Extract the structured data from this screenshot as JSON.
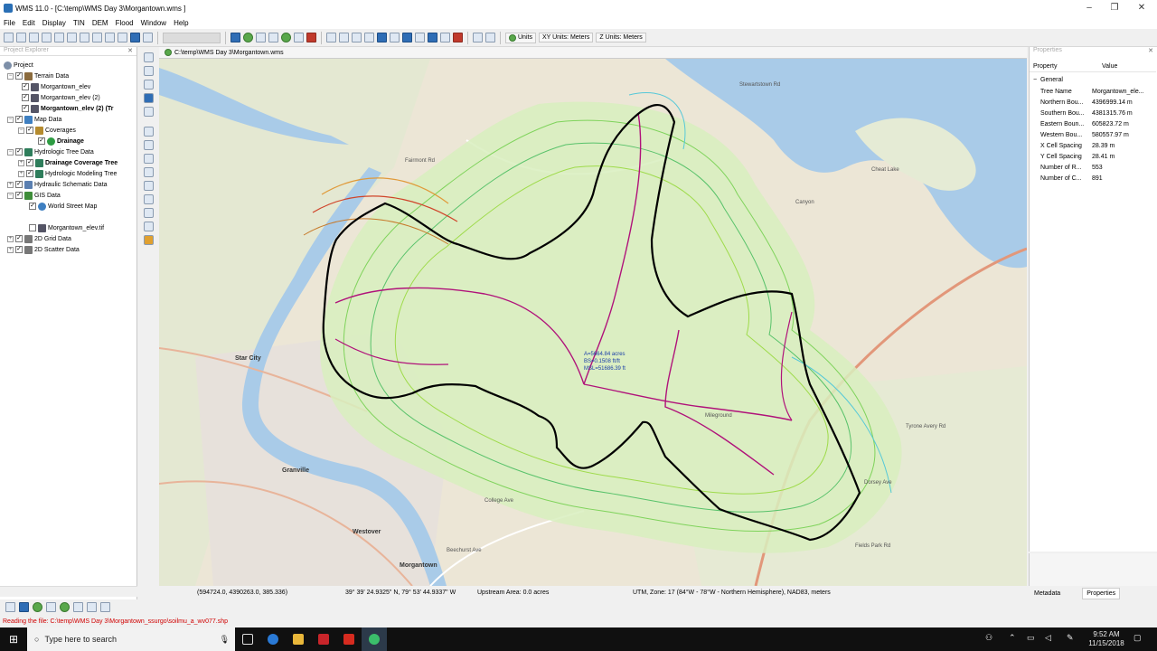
{
  "window": {
    "title": "WMS 11.0 - [C:\\temp\\WMS Day 3\\Morgantown.wms ]",
    "min": "–",
    "max": "❐",
    "close": "✕"
  },
  "menu": [
    "File",
    "Edit",
    "Display",
    "TIN",
    "DEM",
    "Flood",
    "Window",
    "Help"
  ],
  "toolbar": {
    "units_label": "Units",
    "xy_units": "XY Units: Meters",
    "z_units": "Z Units: Meters"
  },
  "left_panel": {
    "title": "Project Explorer",
    "tree": [
      {
        "label": "Project"
      },
      {
        "label": "Terrain Data"
      },
      {
        "label": "Morgantown_elev"
      },
      {
        "label": "Morgantown_elev (2)"
      },
      {
        "label": "Morgantown_elev (2) (Tr"
      },
      {
        "label": "Map Data"
      },
      {
        "label": "Coverages"
      },
      {
        "label": "Drainage"
      },
      {
        "label": "Hydrologic Tree Data"
      },
      {
        "label": "Drainage Coverage Tree"
      },
      {
        "label": "Hydrologic Modeling Tree"
      },
      {
        "label": "Hydraulic Schematic Data"
      },
      {
        "label": "GIS Data"
      },
      {
        "label": "World Street Map"
      },
      {
        "label": "Morgantown_elev.tif"
      },
      {
        "label": "2D Grid Data"
      },
      {
        "label": "2D Scatter Data"
      }
    ]
  },
  "map_tab": {
    "path": "C:\\temp\\WMS Day 3\\Morgantown.wms"
  },
  "map": {
    "basin_label": [
      "A=5664.84 acres",
      "BS=0.1508 ft/ft",
      "MSL=51686.39 ft"
    ],
    "places": [
      "Star City",
      "Granville",
      "Westover",
      "Morgantown",
      "Cheat Lake",
      "Canyon",
      "Fairmont Rd",
      "Stewartstown Rd",
      "Tyrone Avery Rd",
      "College Ave",
      "Beechurst Ave",
      "Mileground",
      "Dorsey Ave",
      "Fields Park Rd"
    ]
  },
  "right_panel": {
    "title": "Properties",
    "headers": {
      "property": "Property",
      "value": "Value"
    },
    "group": "General",
    "rows": [
      {
        "k": "Tree Name",
        "v": "Morgantown_ele..."
      },
      {
        "k": "Northern Bou...",
        "v": "4396999.14 m"
      },
      {
        "k": "Southern Bou...",
        "v": "4381315.76 m"
      },
      {
        "k": "Eastern Boun...",
        "v": "605823.72 m"
      },
      {
        "k": "Western Bou...",
        "v": "580557.97 m"
      },
      {
        "k": "X Cell Spacing",
        "v": "28.39 m"
      },
      {
        "k": "Y Cell Spacing",
        "v": "28.41 m"
      },
      {
        "k": "Number of R...",
        "v": "553"
      },
      {
        "k": "Number of C...",
        "v": "891"
      }
    ],
    "tabs": [
      "Metadata",
      "Properties"
    ]
  },
  "status": {
    "coords": "(594724.0, 4390263.0, 385.336)",
    "latlon": "39° 39' 24.9325\" N, 79° 53' 44.9337\" W",
    "upstream": "Upstream Area: 0.0 acres",
    "utm": "UTM, Zone: 17 (84°W - 78°W - Northern Hemisphere), NAD83, meters"
  },
  "reading": "Reading the file: C:\\temp\\WMS Day 3\\Morgantown_ssurgo\\soilmu_a_wv077.shp",
  "taskbar": {
    "search_placeholder": "Type here to search",
    "time": "9:52 AM",
    "date": "11/15/2018"
  },
  "colors": {
    "basin": "#000000",
    "stream": "#b0127a",
    "contour_green": "#7fd35b",
    "water": "#a9cbe8",
    "road": "#e2977a"
  }
}
